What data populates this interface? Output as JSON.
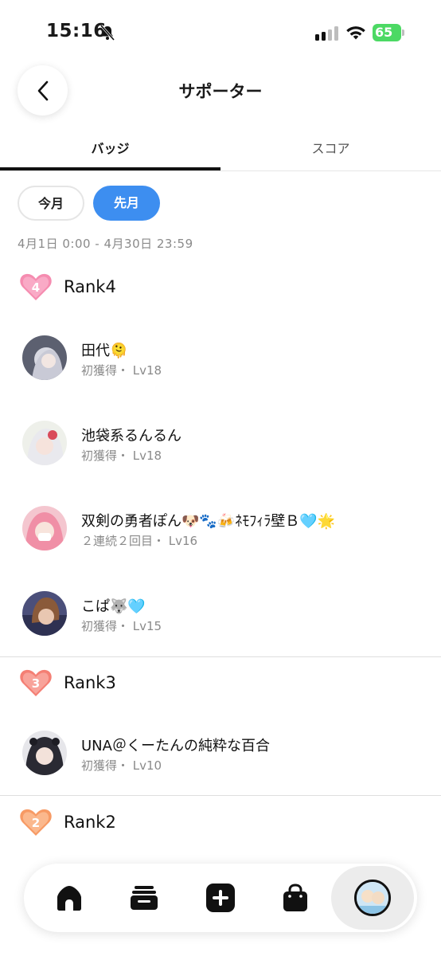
{
  "status_bar": {
    "time": "15:16",
    "battery": "65"
  },
  "header": {
    "title": "サポーター"
  },
  "tabs": [
    {
      "label": "バッジ",
      "active": true
    },
    {
      "label": "スコア",
      "active": false
    }
  ],
  "period": {
    "options": [
      {
        "label": "今月",
        "selected": false
      },
      {
        "label": "先月",
        "selected": true
      }
    ],
    "date_range": "4月1日 0:00 - 4月30日 23:59"
  },
  "sections": [
    {
      "title": "Rank4",
      "badge_number": "4",
      "badge_color": "#f27aa2",
      "supporters": [
        {
          "name": "田代🫠",
          "meta": "初獲得・ Lv18"
        },
        {
          "name": "池袋系るんるん",
          "meta": "初獲得・ Lv18"
        },
        {
          "name": "双剣の勇者ぽん🐶🐾🍻ﾈﾓﾌｨﾗ壁Ｂ🩵🌟",
          "meta": "２連続２回目・ Lv16"
        },
        {
          "name": "こぱ🐺🩵",
          "meta": "初獲得・ Lv15"
        }
      ]
    },
    {
      "title": "Rank3",
      "badge_number": "3",
      "badge_color": "#f0786e",
      "supporters": [
        {
          "name": "UNA＠くーたんの純粋な百合",
          "meta": "初獲得・ Lv10"
        }
      ]
    },
    {
      "title": "Rank2",
      "badge_number": "2",
      "badge_color": "#f59a62",
      "supporters": []
    }
  ],
  "colors": {
    "accent": "#3d8ef0",
    "text_primary": "#111111",
    "text_secondary": "#8a8a8a"
  },
  "bottom_nav": [
    {
      "icon": "home-icon"
    },
    {
      "icon": "inbox-icon"
    },
    {
      "icon": "add-icon"
    },
    {
      "icon": "shop-bag-icon"
    },
    {
      "icon": "profile-avatar"
    }
  ]
}
